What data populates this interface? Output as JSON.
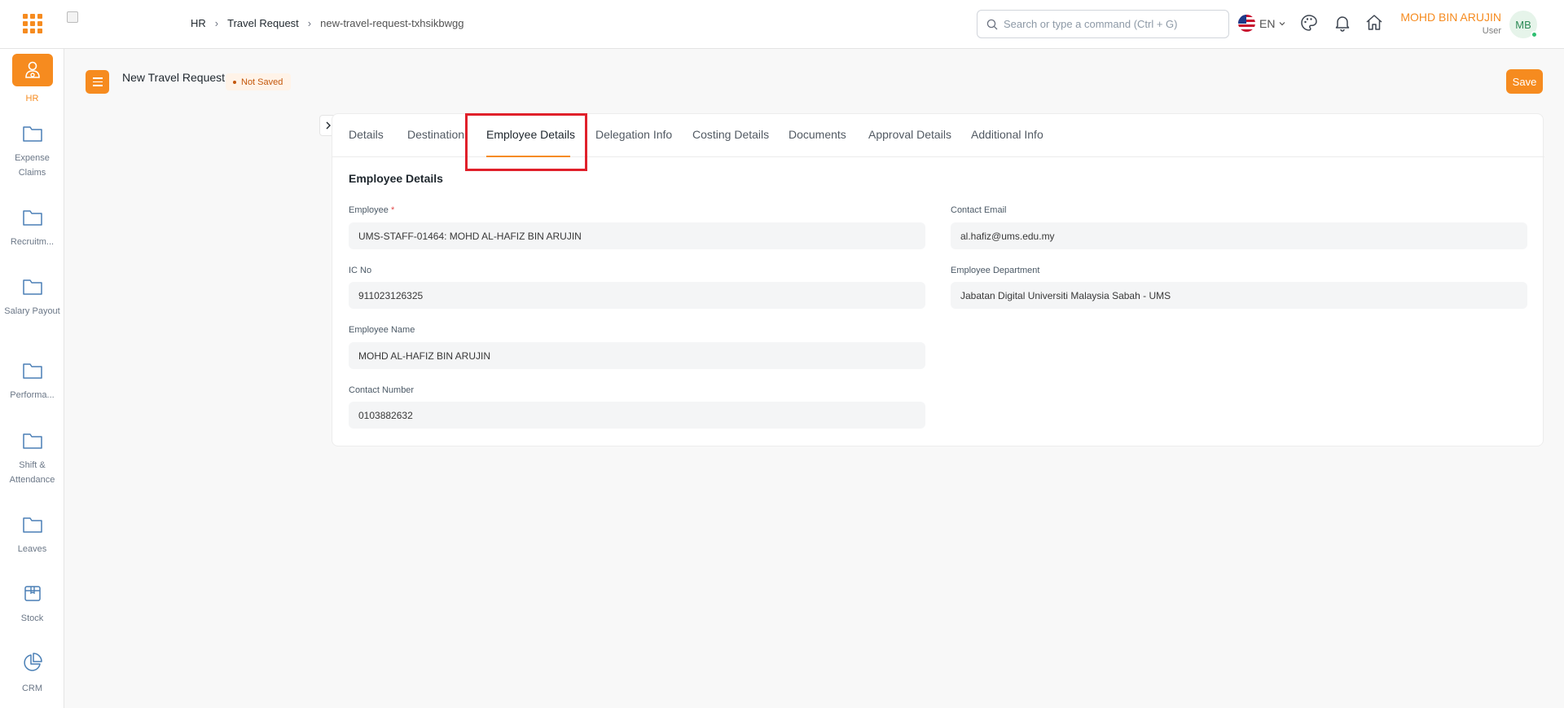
{
  "navbar": {
    "breadcrumbs": [
      "HR",
      "Travel Request",
      "new-travel-request-txhsikbwgg"
    ],
    "search_placeholder": "Search or type a command (Ctrl + G)",
    "language": "EN",
    "user_name": "MOHD BIN ARUJIN",
    "user_role": "User",
    "avatar_initials": "MB",
    "accent_color": "#f68b1f"
  },
  "sidebar": {
    "items": [
      {
        "label": "HR",
        "icon": "hr-people-icon",
        "active": true
      },
      {
        "label": "Expense Claims",
        "icon": "folder-icon"
      },
      {
        "label": "Recruitm...",
        "icon": "folder-icon"
      },
      {
        "label": "Salary Payout",
        "icon": "folder-icon"
      },
      {
        "label": "Performa...",
        "icon": "folder-icon"
      },
      {
        "label": "Shift & Attendance",
        "icon": "folder-icon"
      },
      {
        "label": "Leaves",
        "icon": "folder-icon"
      },
      {
        "label": "Stock",
        "icon": "box-icon"
      },
      {
        "label": "CRM",
        "icon": "pie-chart-icon"
      }
    ]
  },
  "page": {
    "title": "New Travel Request",
    "status": "Not Saved",
    "save_label": "Save"
  },
  "tabs": [
    "Details",
    "Destination",
    "Employee Details",
    "Delegation Info",
    "Costing Details",
    "Documents",
    "Approval Details",
    "Additional Info"
  ],
  "active_tab": "Employee Details",
  "form": {
    "section_title": "Employee Details",
    "employee_label": "Employee",
    "employee_required": "*",
    "employee_value": "UMS-STAFF-01464: MOHD AL-HAFIZ BIN ARUJIN",
    "ic_label": "IC No",
    "ic_value": "911023126325",
    "name_label": "Employee Name",
    "name_value": "MOHD AL-HAFIZ BIN ARUJIN",
    "contact_number_label": "Contact Number",
    "contact_number_value": "0103882632",
    "email_label": "Contact Email",
    "email_value": "al.hafiz@ums.edu.my",
    "department_label": "Employee Department",
    "department_value": "Jabatan Digital Universiti Malaysia Sabah - UMS"
  }
}
